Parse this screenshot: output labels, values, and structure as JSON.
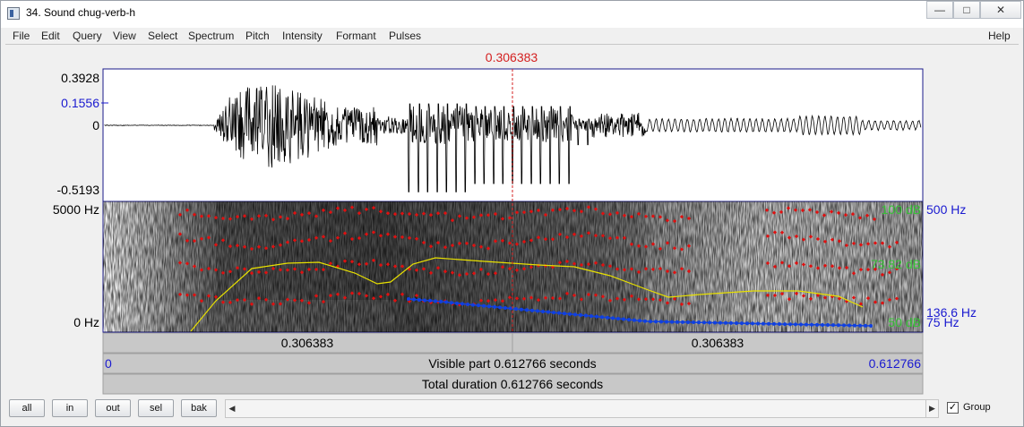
{
  "window": {
    "title": "34. Sound chug-verb-h"
  },
  "window_buttons": {
    "minimize": "—",
    "maximize": "□",
    "close": "✕"
  },
  "menu": [
    "File",
    "Edit",
    "Query",
    "View",
    "Select",
    "Spectrum",
    "Pitch",
    "Intensity",
    "Formant",
    "Pulses"
  ],
  "help": "Help",
  "cursor": {
    "time_label": "0.306383",
    "fraction": 0.5
  },
  "waveform": {
    "ymax": "0.3928",
    "ycursor": "0.1556",
    "yzero": "0",
    "ymin": "-0.5193"
  },
  "spectrogram": {
    "freq_top": "5000 Hz",
    "freq_bottom": "0 Hz",
    "intensity_max": "100 dB",
    "intensity_current": "73.82 dB",
    "intensity_min": "50 dB",
    "pitch_top": "500 Hz",
    "pitch_current": "136.6 Hz",
    "pitch_bottom": "75 Hz"
  },
  "time_bar": {
    "left_half": "0.306383",
    "right_half": "0.306383",
    "start": "0",
    "end": "0.612766",
    "visible": "Visible part 0.612766 seconds",
    "total": "Total duration 0.612766 seconds"
  },
  "buttons": [
    "all",
    "in",
    "out",
    "sel",
    "bak"
  ],
  "scroll": {
    "left": "◀",
    "right": "▶"
  },
  "group": {
    "label": "Group",
    "checked": true
  },
  "colors": {
    "cursor": "#d42020",
    "axis_blue": "#1a1ad0",
    "intensity_green": "#36c236",
    "formant_red": "#e01010",
    "intensity_yellow": "#e8e000",
    "pitch_blue": "#1040e0"
  }
}
